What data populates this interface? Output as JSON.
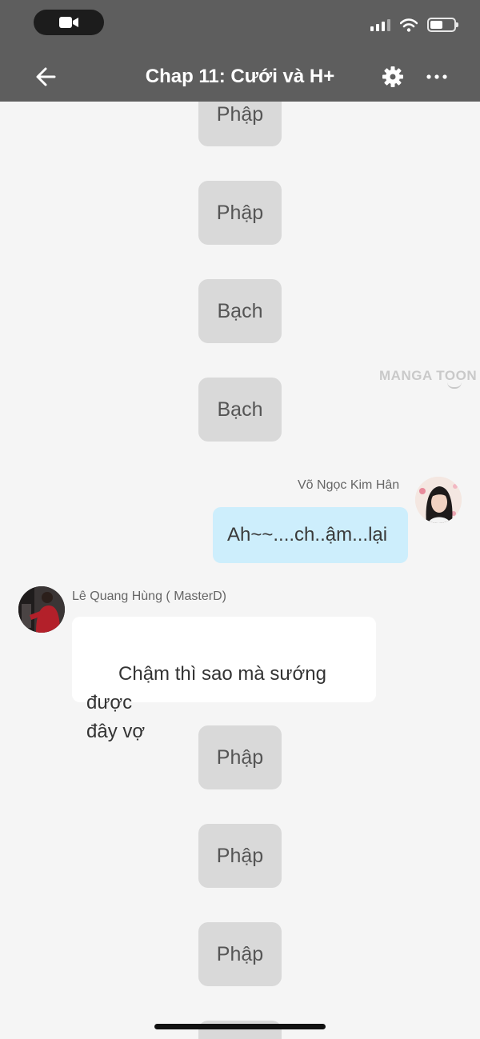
{
  "header": {
    "title": "Chap 11: Cưới và H+"
  },
  "icons": {
    "camera": "video-camera-icon",
    "signal": "cellular-signal-icon",
    "wifi": "wifi-icon",
    "battery": "battery-icon",
    "back": "arrow-left-icon",
    "settings": "gear-icon",
    "more": "more-horizontal-icon"
  },
  "status": {
    "battery_level": 0.55
  },
  "watermark": "MANGA TOON",
  "messages": {
    "sfx": [
      "Phập",
      "Phập",
      "Bạch",
      "Bạch",
      "Phập",
      "Phập",
      "Phập"
    ],
    "right": {
      "sender": "Võ Ngọc Kim Hân",
      "text": "Ah~~....ch..ậm...lại"
    },
    "left": {
      "sender": "Lê Quang Hùng ( MasterD)",
      "text": "Chậm thì sao mà sướng được\nđây vợ"
    }
  },
  "colors": {
    "header_bg": "#5e5e5e",
    "chat_bg": "#f5f5f5",
    "sfx_bg": "#d9d9d9",
    "right_bubble_bg": "#cdeefc",
    "left_bubble_bg": "#ffffff"
  }
}
